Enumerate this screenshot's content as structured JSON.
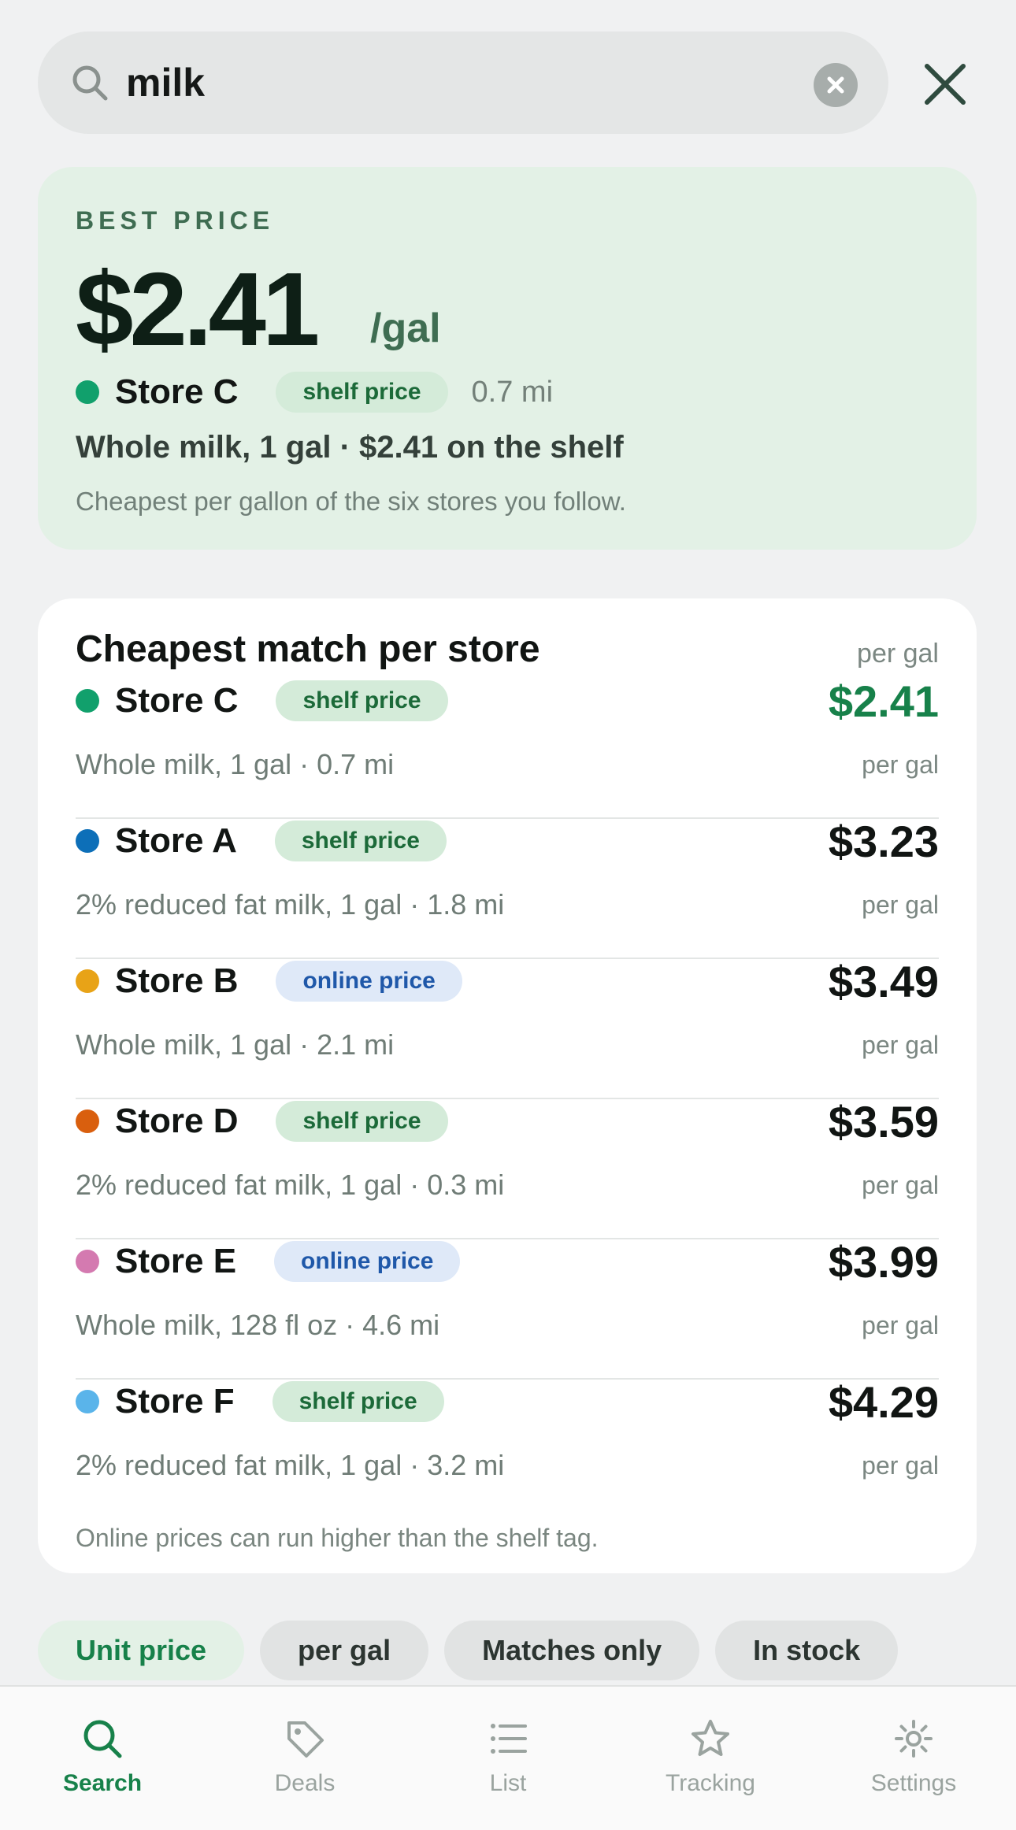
{
  "search": {
    "query": "milk"
  },
  "best": {
    "label": "BEST PRICE",
    "price": "$2.41",
    "unit": "/gal",
    "store": "Store C",
    "store_color": "#11a06c",
    "badge": "shelf price",
    "distance": "0.7 mi",
    "description": "Whole milk, 1 gal · $2.41 on the shelf",
    "note": "Cheapest per gallon of the six stores you follow."
  },
  "list": {
    "title": "Cheapest match per store",
    "unit_header": "per gal",
    "rows": [
      {
        "store": "Store C",
        "color": "#11a06c",
        "badge": "shelf price",
        "sub": "Whole milk, 1 gal · 0.7 mi",
        "price": "$2.41",
        "unit": "per gal"
      },
      {
        "store": "Store A",
        "color": "#0d6fb8",
        "badge": "shelf price",
        "sub": "2% reduced fat milk, 1 gal · 1.8 mi",
        "price": "$3.23",
        "unit": "per gal"
      },
      {
        "store": "Store B",
        "color": "#e8a317",
        "badge": "online price",
        "sub": "Whole milk, 1 gal · 2.1 mi",
        "price": "$3.49",
        "unit": "per gal"
      },
      {
        "store": "Store D",
        "color": "#d95f0e",
        "badge": "shelf price",
        "sub": "2% reduced fat milk, 1 gal · 0.3 mi",
        "price": "$3.59",
        "unit": "per gal"
      },
      {
        "store": "Store E",
        "color": "#d47ab0",
        "badge": "online price",
        "sub": "Whole milk, 128 fl oz · 4.6 mi",
        "price": "$3.99",
        "unit": "per gal"
      },
      {
        "store": "Store F",
        "color": "#5ab4ea",
        "badge": "shelf price",
        "sub": "2% reduced fat milk, 1 gal · 3.2 mi",
        "price": "$4.29",
        "unit": "per gal"
      }
    ],
    "footnote": "Online prices can run higher than the shelf tag."
  },
  "filters": [
    "Unit price",
    "per gal",
    "Matches only",
    "In stock"
  ],
  "tabs": [
    {
      "label": "Search",
      "icon": "search-icon"
    },
    {
      "label": "Deals",
      "icon": "tag-icon"
    },
    {
      "label": "List",
      "icon": "list-icon"
    },
    {
      "label": "Tracking",
      "icon": "star-icon"
    },
    {
      "label": "Settings",
      "icon": "gear-icon"
    }
  ],
  "colors": {
    "accent": "#17814a",
    "best_card_bg": "#e3f1e6",
    "online_badge": "#1f58a9"
  }
}
